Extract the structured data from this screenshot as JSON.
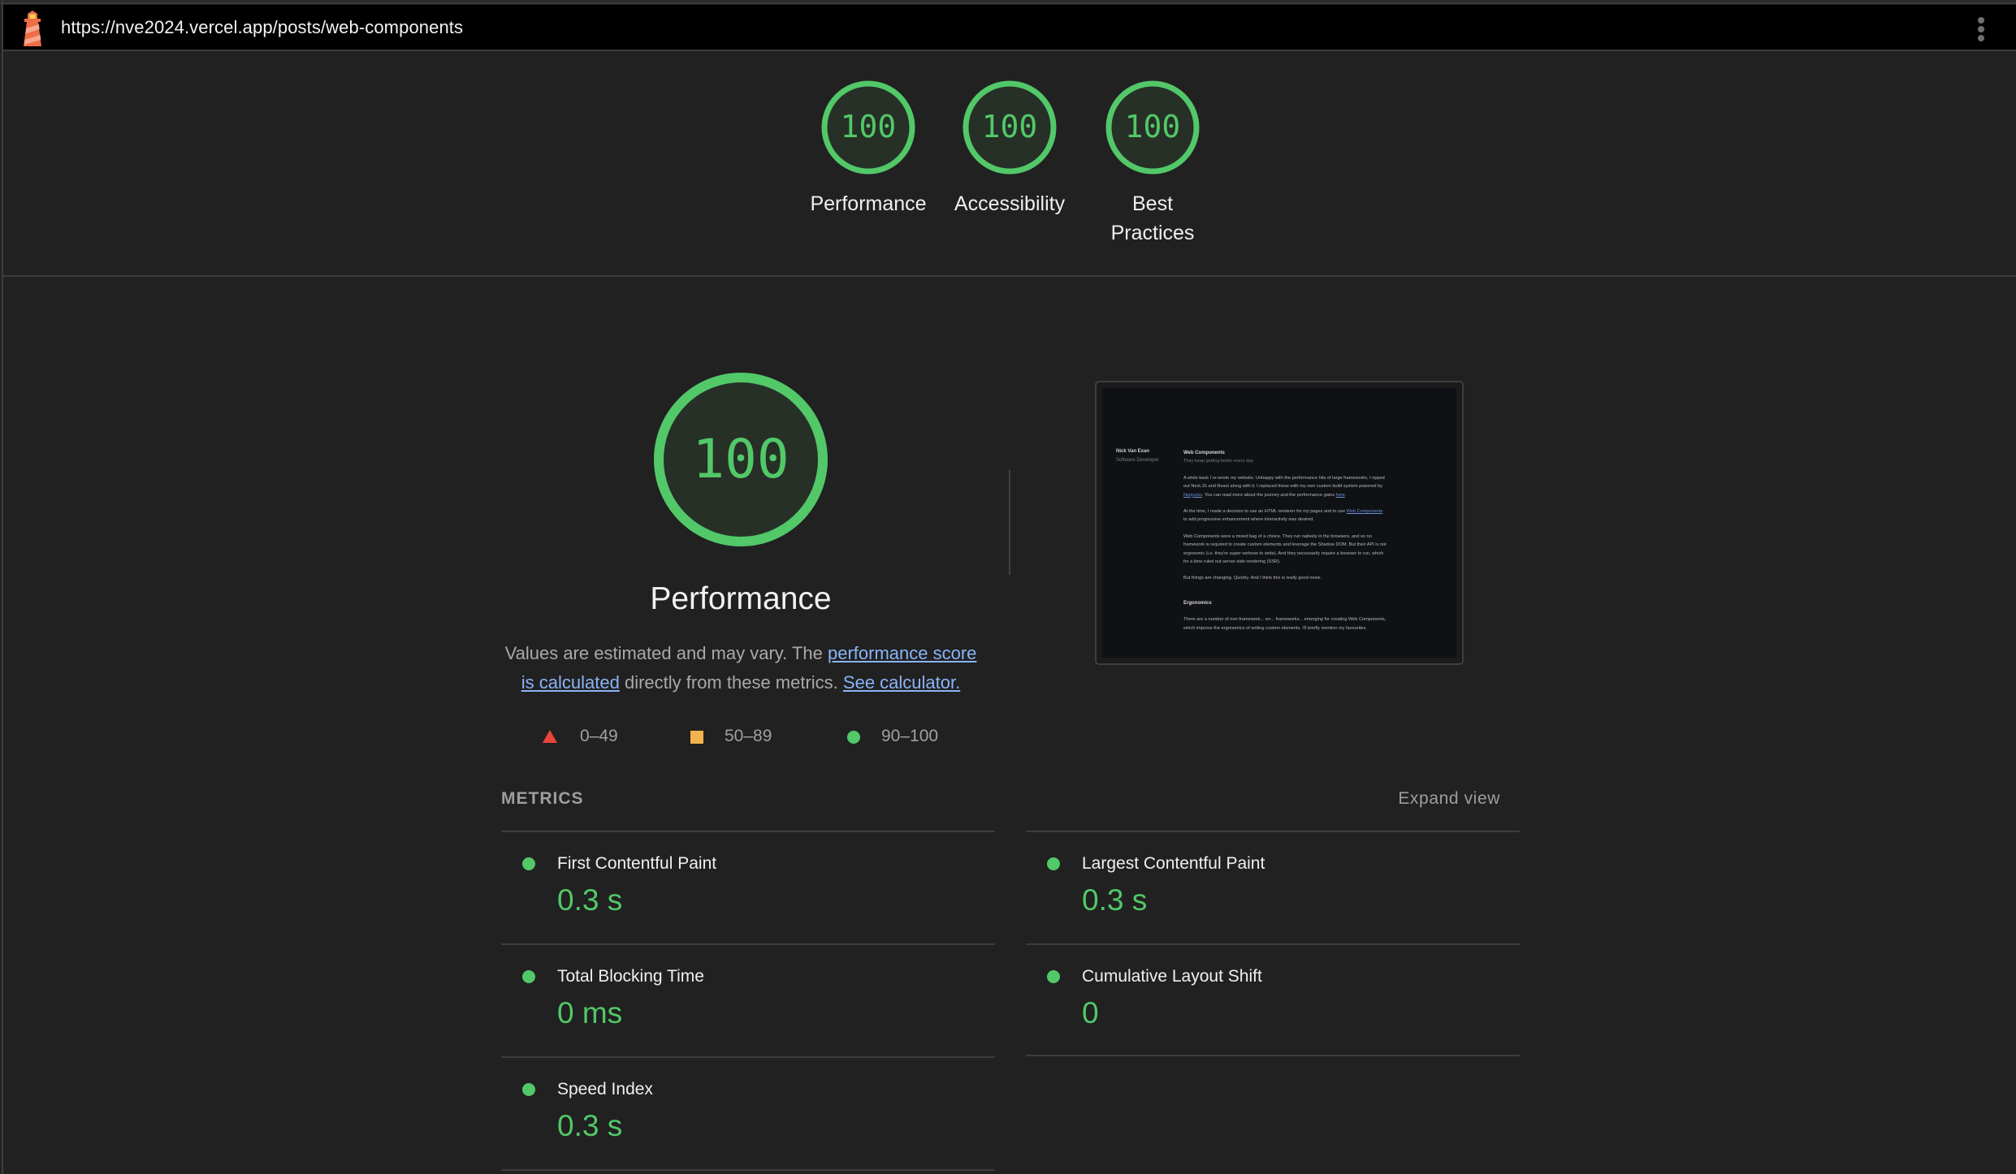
{
  "window": {
    "url": "https://nve2024.vercel.app/posts/web-components",
    "app_icon": "lighthouse-icon",
    "menu_icon": "more-vertical-icon"
  },
  "category_gauges": [
    {
      "name": "performance",
      "label": "Performance",
      "score": "100",
      "color": "#52c868"
    },
    {
      "name": "accessibility",
      "label": "Accessibility",
      "score": "100",
      "color": "#52c868"
    },
    {
      "name": "best-practices",
      "label": "Best Practices",
      "score": "100",
      "color": "#52c868"
    }
  ],
  "performance": {
    "score": "100",
    "title": "Performance",
    "description": {
      "prefix": "Values are estimated and may vary. The ",
      "link1": "performance score is calculated",
      "middle": " directly from these metrics. ",
      "link2": "See calculator."
    },
    "legend": [
      {
        "shape": "triangle",
        "range": "0–49",
        "color": "#e8453c"
      },
      {
        "shape": "square",
        "range": "50–89",
        "color": "#f4b24e"
      },
      {
        "shape": "circle",
        "range": "90–100",
        "color": "#52c868"
      }
    ]
  },
  "thumbnail": {
    "author": "Nick Van Exan",
    "role": "Software Developer",
    "post_title": "Web Components",
    "post_subtitle": "They keep getting better every day",
    "p1_a": "A while back I re-wrote my website. Unhappy with the performance hits of large frameworks, I ripped out Next.JS and React along with it. I replaced those with my own custom build system powered by ",
    "p1_link": "Nunjucks",
    "p1_b": ". You can read more about the journey and the performance gains ",
    "p1_link2": "here",
    "p1_c": ".",
    "p2_a": "At the time, I made a decision to use an HTML renderer for my pages and to use ",
    "p2_link": "Web Components",
    "p2_b": " to add progressive enhancement where interactivity was desired.",
    "p3": "Web Components were a mixed bag of a choice. They run natively in the browsers, and so no framework is required to create custom elements and leverage the Shadow DOM. But their API is not ergonomic (i.e. they're super verbose to write). And they necessarily require a browser to run, which for a time ruled out server-side rendering (SSR).",
    "p4": "But things are changing. Quickly. And I think this is really good news.",
    "h2": "Ergonomics",
    "p5": "There are a number of non-framework... err... frameworks... emerging for creating Web Components, which improve the ergonomics of writing custom elements. I'll briefly mention my favourites."
  },
  "metrics": {
    "header": "METRICS",
    "expand_label": "Expand view",
    "items": [
      {
        "title": "First Contentful Paint",
        "value": "0.3 s",
        "status": "good"
      },
      {
        "title": "Largest Contentful Paint",
        "value": "0.3 s",
        "status": "good"
      },
      {
        "title": "Total Blocking Time",
        "value": "0 ms",
        "status": "good"
      },
      {
        "title": "Cumulative Layout Shift",
        "value": "0",
        "status": "good"
      },
      {
        "title": "Speed Index",
        "value": "0.3 s",
        "status": "good"
      }
    ]
  }
}
